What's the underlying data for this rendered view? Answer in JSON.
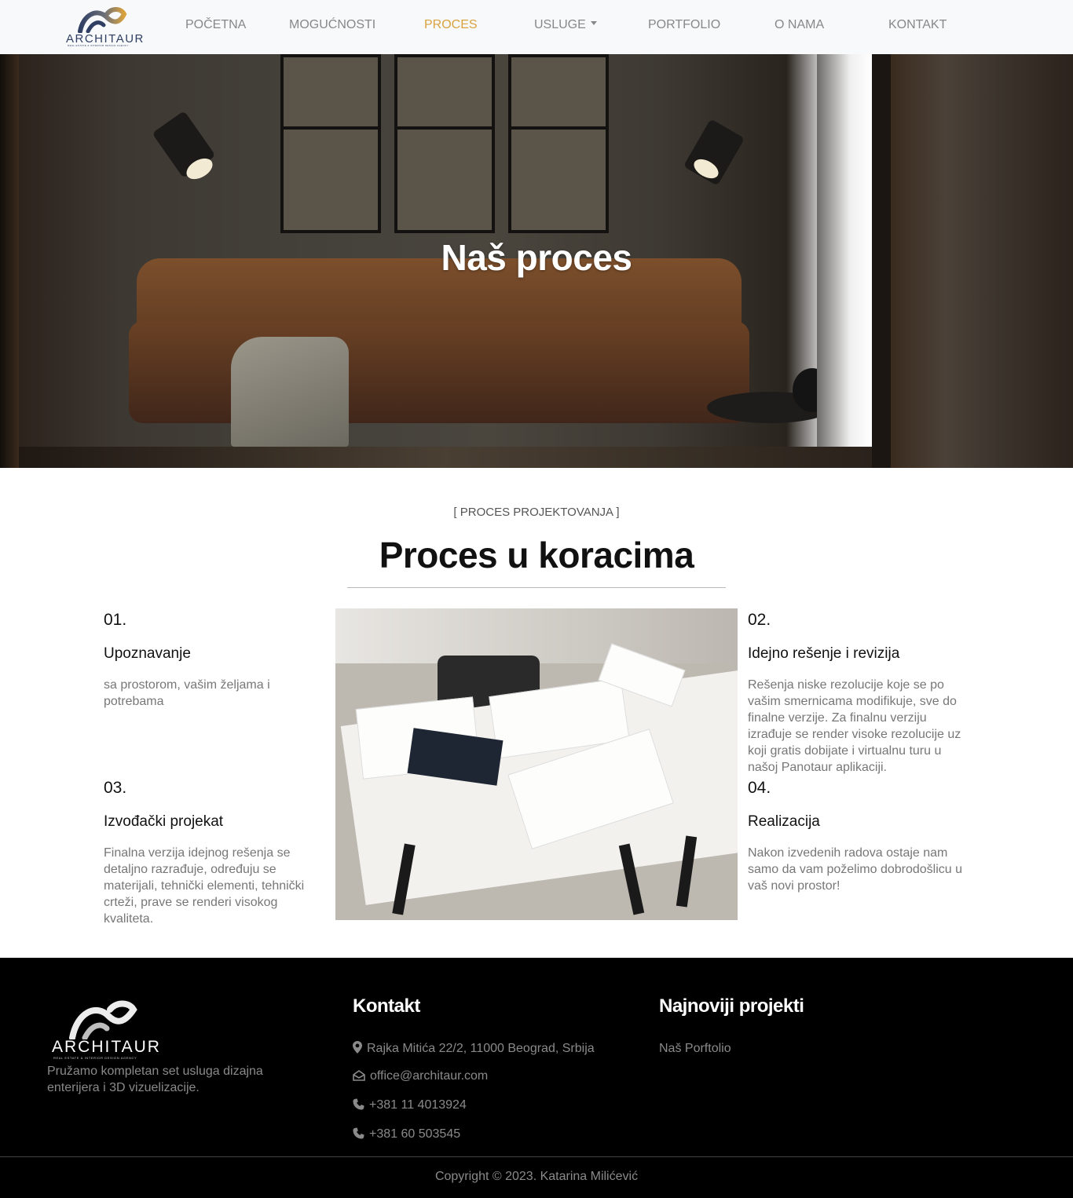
{
  "nav": {
    "logo_text": "ARCHITAUR",
    "logo_sub": "REAL ESTATE & INTERIOR DESIGN AGENCY",
    "items": [
      {
        "label": "POČETNA"
      },
      {
        "label": "MOGUĆNOSTI"
      },
      {
        "label": "PROCES"
      },
      {
        "label": "USLUGE"
      },
      {
        "label": "PORTFOLIO"
      },
      {
        "label": "O NAMA"
      },
      {
        "label": "KONTAKT"
      }
    ],
    "active_index": 2,
    "dropdown_index": 3
  },
  "hero": {
    "title": "Naš proces"
  },
  "process": {
    "eyebrow": "[ PROCES PROJEKTOVANJA ]",
    "title": "Proces u koracima",
    "steps": [
      {
        "num": "01.",
        "title": "Upoznavanje",
        "text": "sa prostorom, vašim željama i potrebama"
      },
      {
        "num": "02.",
        "title": "Idejno rešenje i revizija",
        "text": "Rešenja niske rezolucije koje se po vašim smernicama modifikuje, sve do finalne verzije. Za finalnu verziju izrađuje se render visoke rezolucije uz koji gratis dobijate i virtualnu turu u našoj Panotaur aplikaciji."
      },
      {
        "num": "03.",
        "title": "Izvođački projekat",
        "text": "Finalna verzija idejnog rešenja se detaljno razrađuje, određuju se materijali, tehnički elementi, tehnički crteži, prave se renderi visokog kvaliteta."
      },
      {
        "num": "04.",
        "title": "Realizacija",
        "text": "Nakon izvedenih radova ostaje nam samo da vam poželimo dobrodošlicu u vaš novi prostor!"
      }
    ]
  },
  "footer": {
    "logo_text": "ARCHITAUR",
    "logo_sub": "REAL ESTATE & INTERIOR DESIGN AGENCY",
    "description": "Pružamo kompletan set usluga dizajna enterijera i 3D vizuelizacije.",
    "contact_heading": "Kontakt",
    "address": "Rajka Mitića 22/2, 11000 Beograd, Srbija",
    "email": "office@architaur.com",
    "phone1": "+381 11 4013924",
    "phone2": "+381 60 503545",
    "projects_heading": "Najnoviji projekti",
    "portfolio_link": "Naš Porftolio",
    "copyright": "Copyright © 2023. Katarina Milićević"
  },
  "colors": {
    "accent": "#d9a23f",
    "nav_text": "#888888",
    "footer_bg": "#000000",
    "logo_navy": "#2f3f63"
  }
}
